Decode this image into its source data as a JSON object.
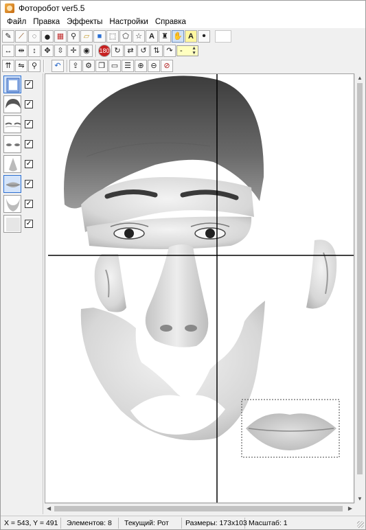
{
  "window": {
    "title": "Фоторобот   ver5.5"
  },
  "menu": [
    "Файл",
    "Правка",
    "Эффекты",
    "Настройки",
    "Справка"
  ],
  "toolbar": {
    "row1": [
      {
        "name": "pencil-icon",
        "glyph": "✎"
      },
      {
        "name": "brush-icon",
        "glyph": "🖌"
      },
      {
        "name": "lasso-icon",
        "glyph": "◌"
      },
      {
        "name": "black-color-icon",
        "glyph": "●"
      },
      {
        "name": "palette-icon",
        "glyph": "▦"
      },
      {
        "name": "eyedropper-icon",
        "glyph": "⚲"
      },
      {
        "name": "eraser-icon",
        "glyph": "⌫"
      },
      {
        "name": "fill-rect-icon",
        "glyph": "■"
      },
      {
        "name": "rect-select-icon",
        "glyph": "⬚"
      },
      {
        "name": "poly-select-icon",
        "glyph": "⬠"
      },
      {
        "name": "star-select-icon",
        "glyph": "☆"
      },
      {
        "name": "text-icon",
        "glyph": "A"
      },
      {
        "name": "stamp-icon",
        "glyph": "♜"
      },
      {
        "name": "hand-icon",
        "glyph": "✋"
      },
      {
        "name": "text-highlight-icon",
        "glyph": "A"
      },
      {
        "name": "dot-icon",
        "glyph": "•"
      }
    ],
    "row2": [
      {
        "name": "stretch-horizontal-icon",
        "glyph": "↔"
      },
      {
        "name": "shrink-horizontal-icon",
        "glyph": "⇹"
      },
      {
        "name": "stretch-vertical-icon",
        "glyph": "↕"
      },
      {
        "name": "move-icon",
        "glyph": "✥"
      },
      {
        "name": "shrink-vertical-icon",
        "glyph": "⇳"
      },
      {
        "name": "move-all-icon",
        "glyph": "✛"
      },
      {
        "name": "mask-icon",
        "glyph": "◉"
      },
      {
        "name": "rotate-180-icon",
        "glyph": "⟲"
      },
      {
        "name": "rotate-cw-icon",
        "glyph": "↻"
      },
      {
        "name": "swap-icon",
        "glyph": "⇄"
      },
      {
        "name": "rotate-ccw-icon",
        "glyph": "↺"
      },
      {
        "name": "flip-vertical-icon",
        "glyph": "⇅"
      },
      {
        "name": "rotate-free-icon",
        "glyph": "↷"
      }
    ],
    "spin_value": "-",
    "row3": [
      {
        "name": "align-icon",
        "glyph": "⇈"
      },
      {
        "name": "mirror-icon",
        "glyph": "⇋"
      },
      {
        "name": "zoom-icon",
        "glyph": "⚲"
      },
      {
        "name": "undo-icon",
        "glyph": "↶"
      },
      {
        "name": "layer-up-icon",
        "glyph": "⇪"
      },
      {
        "name": "settings-gear-icon",
        "glyph": "⚙"
      },
      {
        "name": "layers-icon",
        "glyph": "❐"
      },
      {
        "name": "frame-icon",
        "glyph": "▭"
      },
      {
        "name": "stack-icon",
        "glyph": "☰"
      },
      {
        "name": "zoom-in-icon",
        "glyph": "⊕"
      },
      {
        "name": "zoom-out-icon",
        "glyph": "⊖"
      },
      {
        "name": "zoom-reset-icon",
        "glyph": "⊘"
      }
    ]
  },
  "layers": [
    {
      "name": "layer-background-thumb",
      "checked": true
    },
    {
      "name": "layer-hair-thumb",
      "checked": true
    },
    {
      "name": "layer-brows-thumb",
      "checked": true
    },
    {
      "name": "layer-eyes-thumb",
      "checked": true
    },
    {
      "name": "layer-nose-thumb",
      "checked": true
    },
    {
      "name": "layer-mouth-thumb",
      "checked": true
    },
    {
      "name": "layer-chin-thumb",
      "checked": true
    },
    {
      "name": "layer-extra-thumb",
      "checked": true
    }
  ],
  "status": {
    "coords": "X = 543, Y = 491",
    "elements": "Элементов: 8",
    "current": "Текущий: Рот",
    "size": "Размеры: 173x103",
    "scale": "Масштаб: 1"
  }
}
